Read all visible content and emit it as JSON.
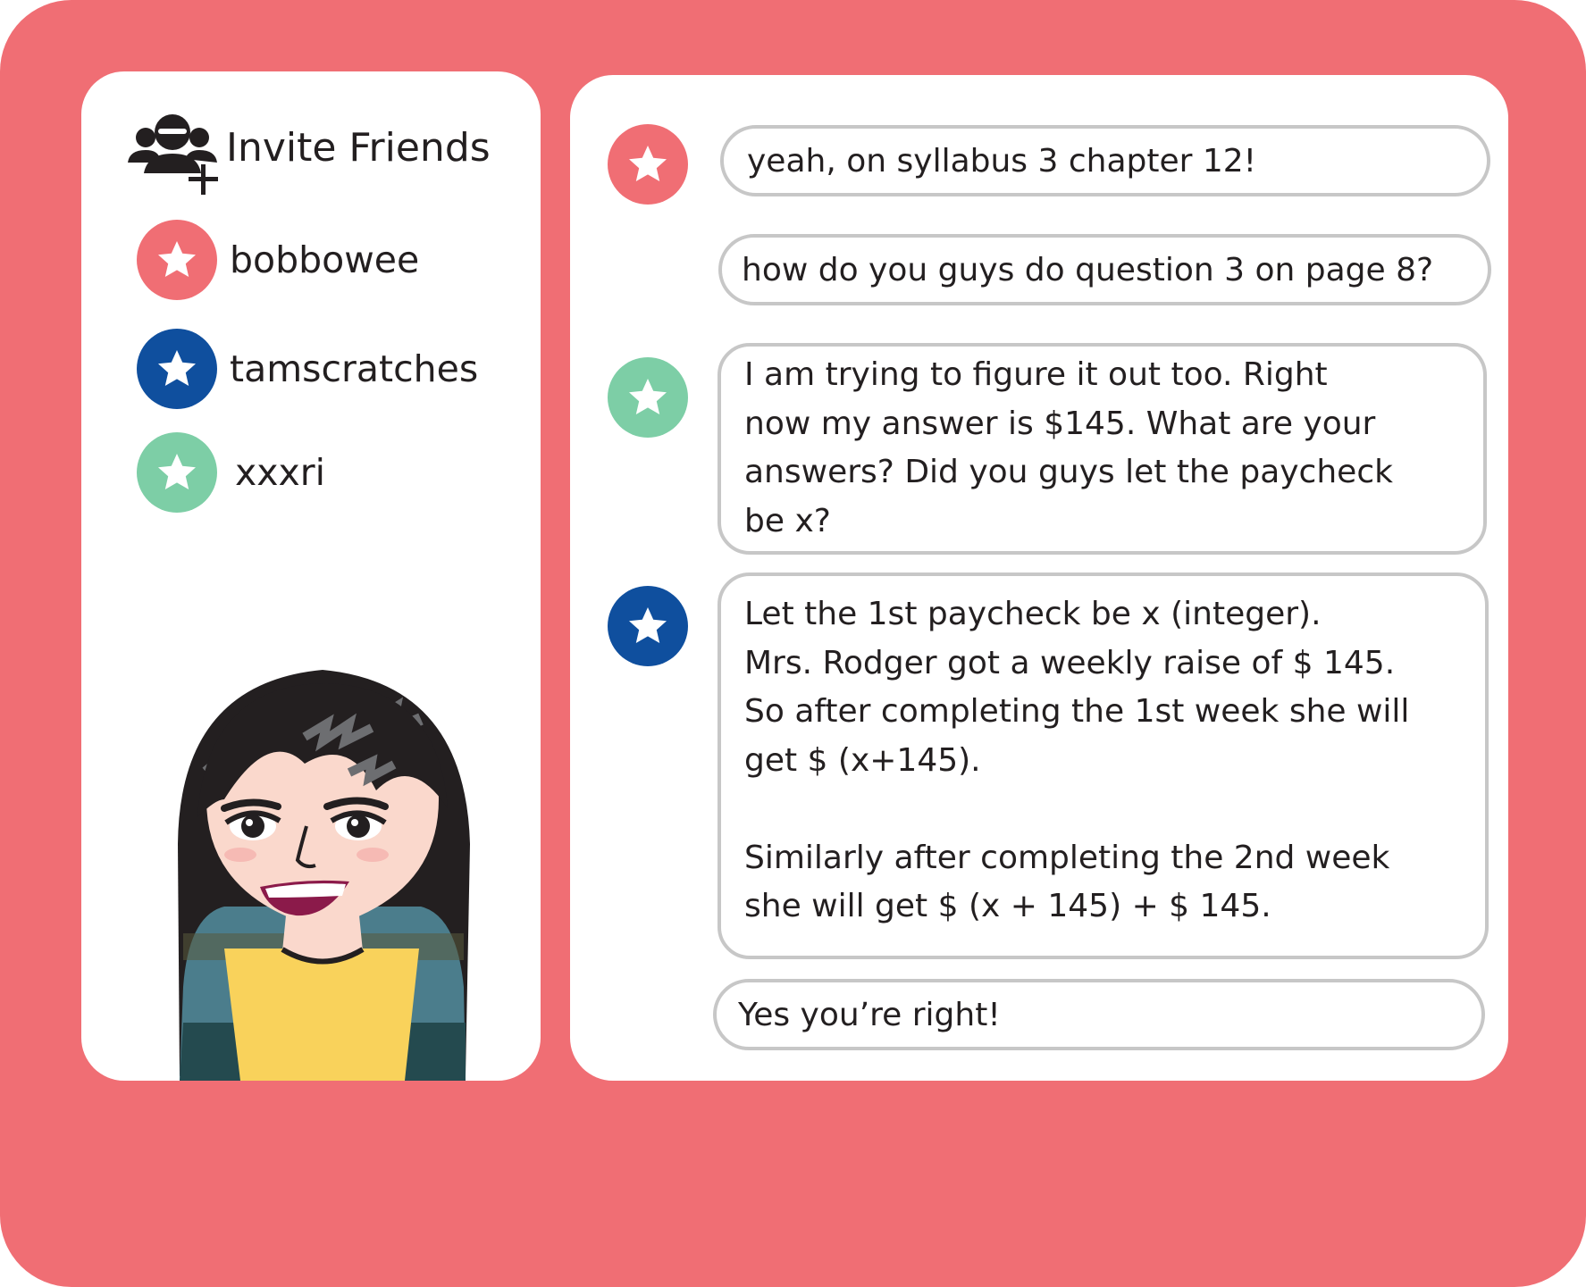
{
  "colors": {
    "frame": "#f06e74",
    "panel": "#ffffff",
    "bubble_border": "#c7c7c7",
    "user_red": "#f06e74",
    "user_blue": "#0f4f9e",
    "user_green": "#7dcea6"
  },
  "sidebar": {
    "invite": {
      "icon": "add-group-icon",
      "label": "Invite Friends"
    },
    "friends": [
      {
        "name": "bobbowee",
        "color": "#f06e74",
        "icon": "star-icon"
      },
      {
        "name": "tamscratches",
        "color": "#0f4f9e",
        "icon": "star-icon"
      },
      {
        "name": "xxxri",
        "color": "#7dcea6",
        "icon": "star-icon"
      }
    ],
    "profile_avatar": "girl-avatar-illustration"
  },
  "chat": {
    "messages": [
      {
        "sender_color": "#f06e74",
        "lines": [
          "yeah, on syllabus 3 chapter 12!"
        ]
      },
      {
        "sender_color": null,
        "lines": [
          "how do you guys do question 3 on page 8?"
        ]
      },
      {
        "sender_color": "#7dcea6",
        "lines": [
          "I am trying to figure it out too. Right",
          "now my answer is $145. What are your",
          "answers? Did you guys let the paycheck",
          "be x?"
        ]
      },
      {
        "sender_color": "#0f4f9e",
        "lines": [
          "Let the 1st paycheck be x (integer).",
          "Mrs. Rodger got a weekly raise of $ 145.",
          "So after completing the 1st week she will",
          "get $ (x+145).",
          "",
          "Similarly after completing the 2nd week",
          "she will get $ (x + 145) + $ 145."
        ]
      },
      {
        "sender_color": null,
        "lines": [
          "Yes you’re right!"
        ]
      }
    ]
  }
}
